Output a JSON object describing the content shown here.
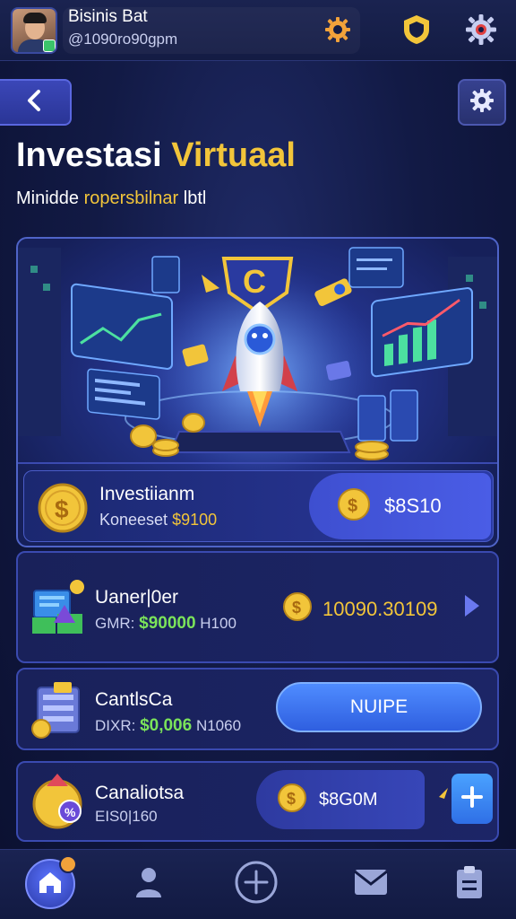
{
  "header": {
    "user_name": "Bisinis Bat",
    "user_handle": "@1090ro90gpm"
  },
  "page": {
    "title_part1": "Investasi",
    "title_part2": "Virtuaal",
    "subtitle_part1": "Minidde",
    "subtitle_part2": "ropersbilnar",
    "subtitle_part3": "lbtl"
  },
  "hero": {
    "label": "Investiianm",
    "sublabel_prefix": "Koneeset",
    "sublabel_value": "$9100",
    "value": "$8S10"
  },
  "cards": [
    {
      "title": "Uaner|0er",
      "meta_prefix": "GMR:",
      "meta_value": "$90000",
      "meta_suffix": "H100",
      "value": "10090.30109"
    },
    {
      "title": "CantlsCa",
      "meta_prefix": "DIXR:",
      "meta_value": "$0,006",
      "meta_suffix": "N1060",
      "button_label": "NUIPE"
    },
    {
      "title": "Canaliotsa",
      "meta_text": "EIS0|160",
      "value": "$8G0M"
    }
  ],
  "colors": {
    "accent_gold": "#f2c53a",
    "accent_green": "#7be35a",
    "primary_blue": "#3e4fd0",
    "background": "#121a45"
  },
  "icons": {
    "top": [
      "coin-gear-icon",
      "shield-icon",
      "settings-icon"
    ],
    "nav": [
      "home-icon",
      "profile-icon",
      "add-icon",
      "mail-icon",
      "clipboard-icon"
    ]
  }
}
